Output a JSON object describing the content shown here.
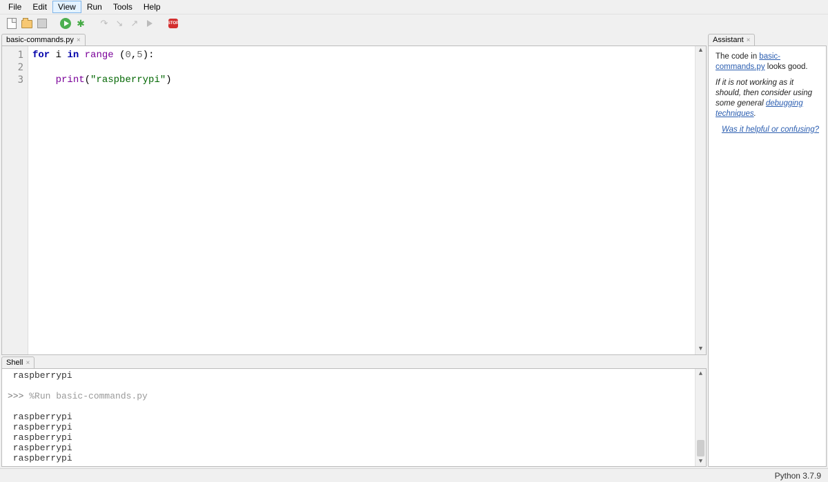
{
  "menubar": [
    "File",
    "Edit",
    "View",
    "Run",
    "Tools",
    "Help"
  ],
  "menubar_highlight_index": 2,
  "toolbar": {
    "new": "New",
    "open": "Open",
    "save": "Save",
    "run": "Run",
    "debug": "Debug",
    "over": "Over",
    "into": "Into",
    "out": "Out",
    "resume": "Resume",
    "stop": "STOP"
  },
  "editor": {
    "tab_label": "basic-commands.py",
    "line_numbers": [
      "1",
      "2",
      "3"
    ],
    "code": {
      "kw_for": "for",
      "var_i": " i ",
      "kw_in": "in",
      "fn_range": " range ",
      "args_open": "(",
      "num0": "0",
      "comma": ",",
      "num5": "5",
      "args_close": "):",
      "indent": "    ",
      "fn_print": "print",
      "paren_open": "(",
      "str": "\"raspberrypi\"",
      "paren_close": ")"
    }
  },
  "shell": {
    "tab_label": "Shell",
    "lines_pre": [
      " raspberrypi"
    ],
    "prompt": ">>> ",
    "run_cmd": "%Run basic-commands.py",
    "output": [
      " raspberrypi",
      " raspberrypi",
      " raspberrypi",
      " raspberrypi",
      " raspberrypi"
    ],
    "prompt2": ">>> "
  },
  "assistant": {
    "tab_label": "Assistant",
    "p1_a": "The code in ",
    "p1_link": "basic-commands.py",
    "p1_b": " looks good.",
    "p2_a": "If it is not working as it should, then consider using some general ",
    "p2_link": "debugging techniques",
    "p2_b": ".",
    "helpful": "Was it helpful or confusing?"
  },
  "status": {
    "python": "Python 3.7.9"
  }
}
